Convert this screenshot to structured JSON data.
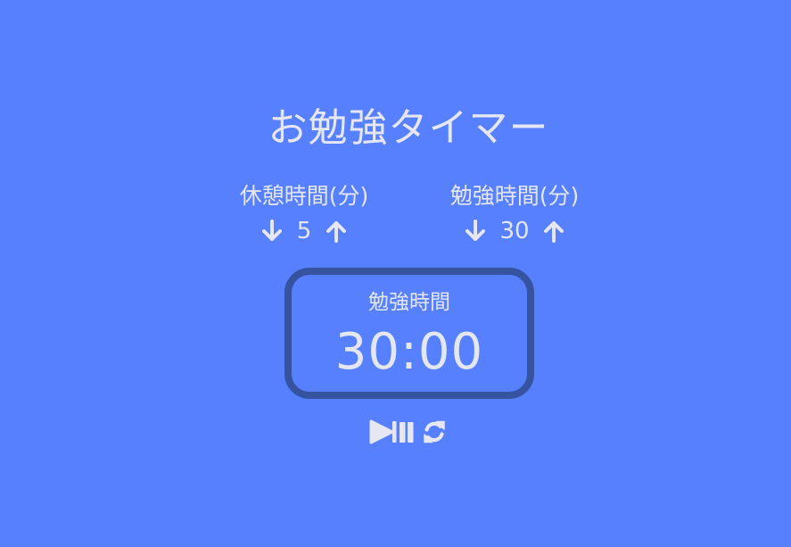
{
  "app": {
    "title": "お勉強タイマー"
  },
  "break_setting": {
    "label": "休憩時間(分)",
    "value": "5",
    "decrement_icon": "arrow-down-icon",
    "increment_icon": "arrow-up-icon"
  },
  "session_setting": {
    "label": "勉強時間(分)",
    "value": "30",
    "decrement_icon": "arrow-down-icon",
    "increment_icon": "arrow-up-icon"
  },
  "timer": {
    "label": "勉強時間",
    "time": "30:00"
  },
  "controls": {
    "play_pause_icon": "play-pause-icon",
    "reset_icon": "refresh-icon"
  },
  "colors": {
    "background": "#5780ff",
    "text": "#e4e6f0",
    "timer_border": "#36539f"
  }
}
